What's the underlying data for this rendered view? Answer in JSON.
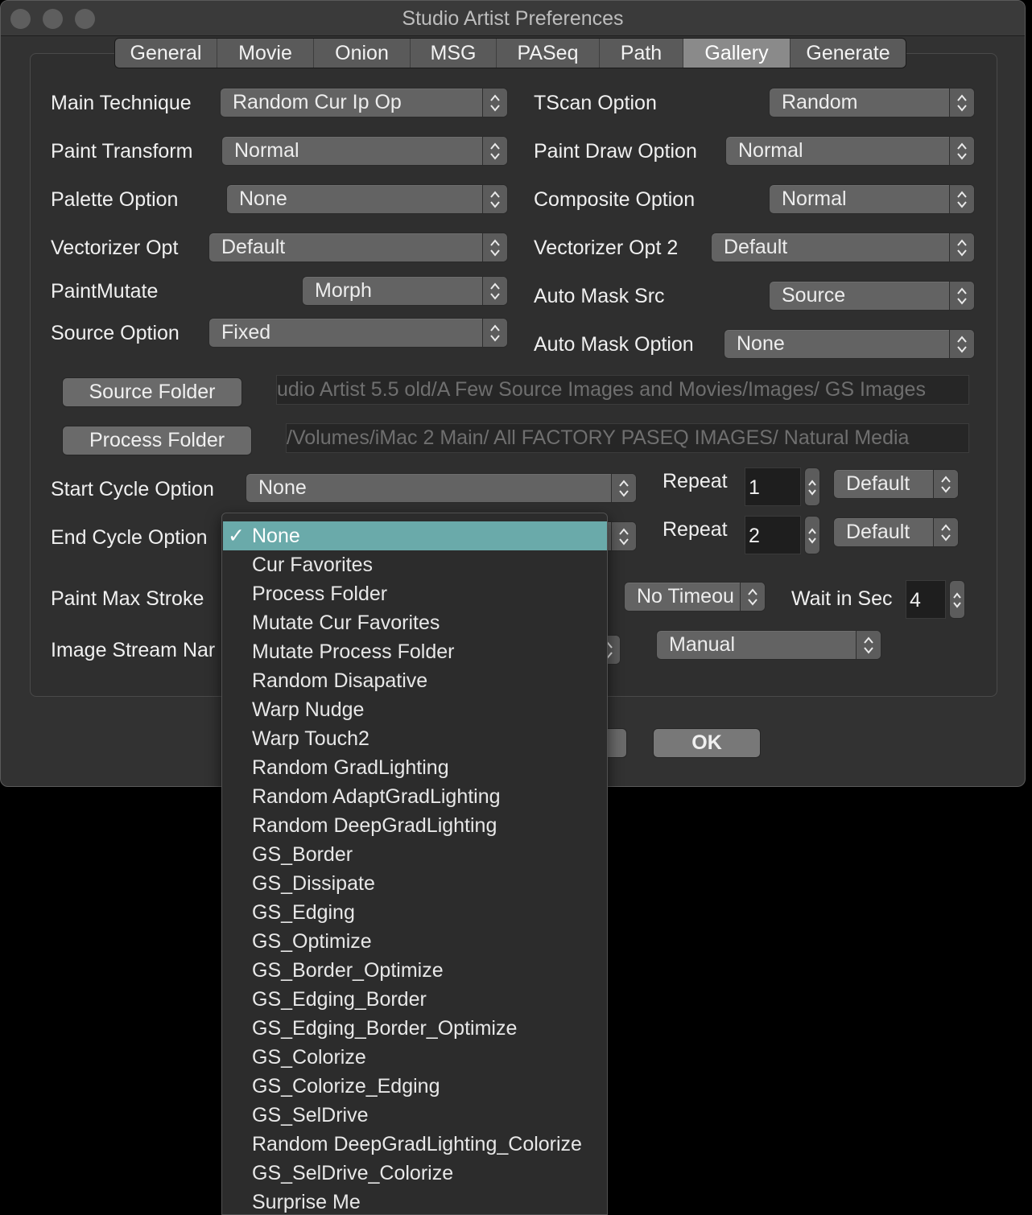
{
  "window": {
    "title": "Studio Artist Preferences"
  },
  "tabs": [
    "General",
    "Movie",
    "Onion",
    "MSG",
    "PASeq",
    "Path",
    "Gallery",
    "Generate"
  ],
  "active_tab": "Gallery",
  "fields": {
    "main_technique": {
      "label": "Main Technique",
      "value": "Random Cur Ip Op"
    },
    "paint_transform": {
      "label": "Paint Transform",
      "value": "Normal"
    },
    "palette_option": {
      "label": "Palette Option",
      "value": "None"
    },
    "vectorizer_opt": {
      "label": "Vectorizer Opt",
      "value": "Default"
    },
    "paint_mutate": {
      "label": "PaintMutate",
      "value": "Morph"
    },
    "source_option": {
      "label": "Source Option",
      "value": "Fixed"
    },
    "tscan_option": {
      "label": "TScan Option",
      "value": "Random"
    },
    "paint_draw_option": {
      "label": "Paint Draw Option",
      "value": "Normal"
    },
    "composite_option": {
      "label": "Composite Option",
      "value": "Normal"
    },
    "vectorizer_opt_2": {
      "label": "Vectorizer Opt 2",
      "value": "Default"
    },
    "auto_mask_src": {
      "label": "Auto Mask Src",
      "value": "Source"
    },
    "auto_mask_option": {
      "label": "Auto Mask Option",
      "value": "None"
    }
  },
  "folders": {
    "source_button": "Source Folder",
    "source_path": "udio Artist 5.5 old/A Few Source Images and Movies/Images/  GS Images",
    "process_button": "Process Folder",
    "process_path": "/Volumes/iMac 2 Main/     All FACTORY PASEQ IMAGES/  Natural Media"
  },
  "cycle": {
    "start_label": "Start Cycle Option",
    "start_value": "None",
    "end_label": "End Cycle Option",
    "repeat_label": "Repeat",
    "start_repeat": "1",
    "end_repeat": "2",
    "start_default": "Default",
    "end_default": "Default"
  },
  "stroke": {
    "label": "Paint Max Stroke",
    "timeout": "No Timeou",
    "wait_label": "Wait in Sec",
    "wait_value": "4"
  },
  "image_stream": {
    "label": "Image Stream Nar",
    "mode": "Manual"
  },
  "buttons": {
    "ok": "OK"
  },
  "end_cycle_menu": {
    "selected": "None",
    "check": "✓",
    "items": [
      "None",
      "Cur Favorites",
      "Process Folder",
      "Mutate Cur Favorites",
      "Mutate Process Folder",
      "Random Disapative",
      "Warp Nudge",
      "Warp Touch2",
      "Random GradLighting",
      "Random AdaptGradLighting",
      "Random DeepGradLighting",
      "GS_Border",
      "GS_Dissipate",
      "GS_Edging",
      "GS_Optimize",
      "GS_Border_Optimize",
      "GS_Edging_Border",
      "GS_Edging_Border_Optimize",
      "GS_Colorize",
      "GS_Colorize_Edging",
      "GS_SelDrive",
      "Random DeepGradLighting_Colorize",
      "GS_SelDrive_Colorize",
      "Surprise Me"
    ]
  },
  "colors": {
    "window_bg": "#323232",
    "popup_bg": "#636363",
    "menu_highlight": "#6aaaaa",
    "active_tab": "#8a8a8a"
  }
}
